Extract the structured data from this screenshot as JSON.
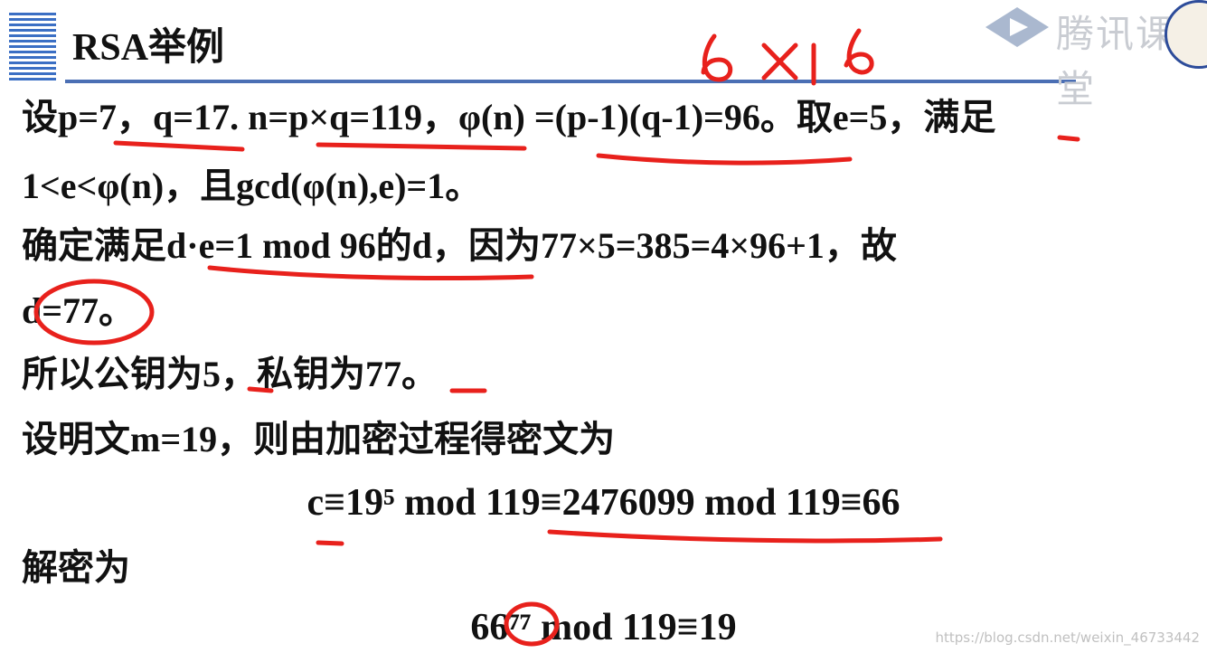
{
  "slide": {
    "title": "RSA举例",
    "logo_text": "腾讯课堂",
    "watermark": "https://blog.csdn.net/weixin_46733442"
  },
  "lines": {
    "l1": "设p=7，q=17. n=p×q=119，φ(n) =(p-1)(q-1)=96。取e=5，满足",
    "l2": "1<e<φ(n)，且gcd(φ(n),e)=1。",
    "l3": "确定满足d·e=1 mod 96的d，因为77×5=385=4×96+1，故",
    "l4": "d=77。",
    "l5": "所以公钥为5，私钥为77。",
    "l6": "设明文m=19，则由加密过程得密文为",
    "formula1": "c≡19⁵ mod 119≡2476099 mod 119≡66",
    "l7": "解密为",
    "formula2": "66⁷⁷ mod 119≡19"
  },
  "annotation": {
    "handwritten_note": "6×16",
    "ink_color": "#e8211c"
  },
  "colors": {
    "accent": "#4b6fb4",
    "ink": "#e8211c"
  }
}
